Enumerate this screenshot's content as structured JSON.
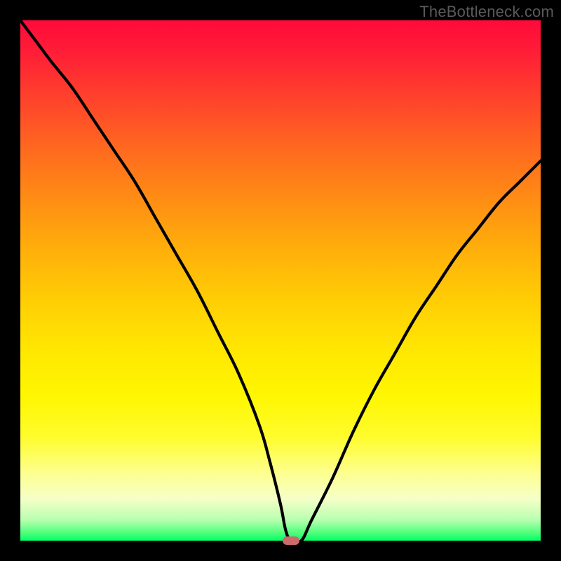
{
  "watermark": "TheBottleneck.com",
  "colors": {
    "frame": "#000000",
    "curve": "#000000",
    "marker": "#cd6a6b"
  },
  "chart_data": {
    "type": "line",
    "title": "",
    "xlabel": "",
    "ylabel": "",
    "xlim": [
      0,
      100
    ],
    "ylim": [
      0,
      100
    ],
    "grid": false,
    "series": [
      {
        "name": "bottleneck-curve",
        "x": [
          0,
          3,
          6,
          10,
          14,
          18,
          22,
          26,
          30,
          34,
          38,
          42,
          46,
          48,
          50,
          51,
          52,
          54,
          56,
          60,
          64,
          68,
          72,
          76,
          80,
          84,
          88,
          92,
          96,
          100
        ],
        "y": [
          100,
          96,
          92,
          87,
          81,
          75,
          69,
          62,
          55,
          48,
          40,
          32,
          22,
          15,
          7,
          2,
          0,
          0,
          4,
          12,
          21,
          29,
          36,
          43,
          49,
          55,
          60,
          65,
          69,
          73
        ]
      }
    ],
    "marker": {
      "x": 52,
      "y": 0,
      "color": "#cd6a6b"
    }
  }
}
